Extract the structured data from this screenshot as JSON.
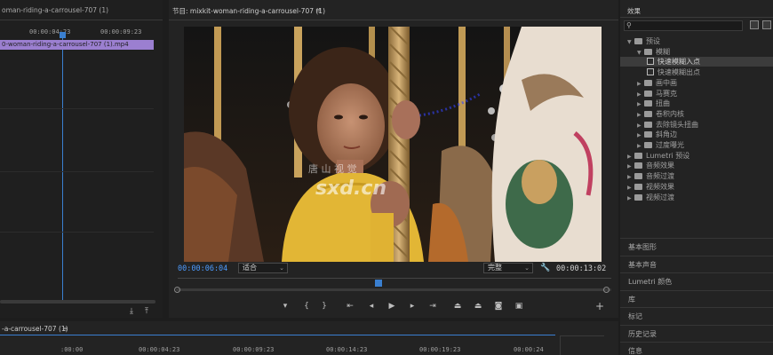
{
  "source": {
    "tab_title": "oman-riding-a-carrousel-707 (1)",
    "timecode_left": "00:00:04:23",
    "timecode_right": "00:00:09:23",
    "clip_label": "0-woman-riding-a-carrousel-707 (1).mp4"
  },
  "program": {
    "tab_title": "节目: mixkit-woman-riding-a-carrousel-707 (1)",
    "menu_glyph": "≡",
    "current_time": "00:00:06:04",
    "fit_dropdown": "适合",
    "quality_dropdown": "完整",
    "duration": "00:00:13:02",
    "watermark_line1": "唐 山 视 觉",
    "watermark_line2": "sxd.cn"
  },
  "effects": {
    "tab_title": "效果",
    "search_placeholder": "",
    "tree": [
      {
        "label": "预设",
        "kind": "folder",
        "level": 0,
        "expanded": true
      },
      {
        "label": "模糊",
        "kind": "folder",
        "level": 1,
        "expanded": true
      },
      {
        "label": "快速模糊入点",
        "kind": "fx",
        "level": 2,
        "selected": true
      },
      {
        "label": "快速模糊出点",
        "kind": "fx",
        "level": 2,
        "selected": false
      },
      {
        "label": "画中画",
        "kind": "folder",
        "level": 1,
        "expanded": false
      },
      {
        "label": "马赛克",
        "kind": "folder",
        "level": 1,
        "expanded": false
      },
      {
        "label": "扭曲",
        "kind": "folder",
        "level": 1,
        "expanded": false
      },
      {
        "label": "卷积内核",
        "kind": "folder",
        "level": 1,
        "expanded": false
      },
      {
        "label": "去除镜头扭曲",
        "kind": "folder",
        "level": 1,
        "expanded": false
      },
      {
        "label": "斜角边",
        "kind": "folder",
        "level": 1,
        "expanded": false
      },
      {
        "label": "过度曝光",
        "kind": "folder",
        "level": 1,
        "expanded": false
      },
      {
        "label": "Lumetri 预设",
        "kind": "folder",
        "level": 0,
        "expanded": false
      },
      {
        "label": "音频效果",
        "kind": "folder",
        "level": 0,
        "expanded": false
      },
      {
        "label": "音频过渡",
        "kind": "folder",
        "level": 0,
        "expanded": false
      },
      {
        "label": "视频效果",
        "kind": "folder",
        "level": 0,
        "expanded": false
      },
      {
        "label": "视频过渡",
        "kind": "folder",
        "level": 0,
        "expanded": false
      }
    ],
    "sections": [
      "基本图形",
      "基本声音",
      "Lumetri 颜色",
      "库",
      "标记",
      "历史记录",
      "信息"
    ]
  },
  "timeline": {
    "tab_title": "-a-carrousel-707 (1)",
    "menu_glyph": "≡",
    "ruler": ":00:00",
    "ruler_marks": [
      ":00:00",
      "00:00:04:23",
      "00:00:09:23",
      "00:00:14:23",
      "00:00:19:23",
      "00:00:24"
    ]
  },
  "colors": {
    "accent": "#4d9bff",
    "clip": "#9b7fd0"
  }
}
